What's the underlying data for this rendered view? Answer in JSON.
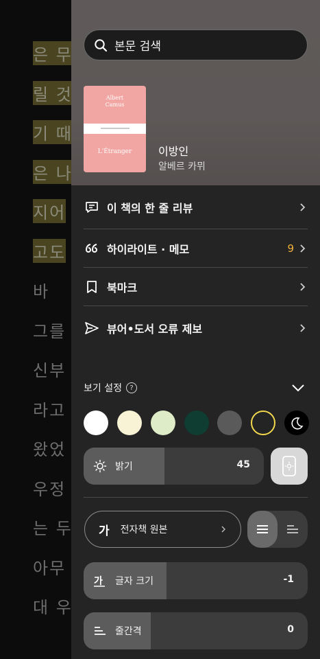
{
  "reader": {
    "lines": [
      {
        "text": "은 무",
        "highlight": true
      },
      {
        "text": "릴 것",
        "highlight": true
      },
      {
        "text": "기 때",
        "highlight": true
      },
      {
        "text": "은 나",
        "highlight": true
      },
      {
        "text": "지어",
        "highlight": true
      },
      {
        "text": "고도",
        "highlight": true
      },
      {
        "text": "   바",
        "highlight": false
      },
      {
        "text": "그를",
        "highlight": false
      },
      {
        "text": "신부",
        "highlight": false
      },
      {
        "text": "라고",
        "highlight": false
      },
      {
        "text": "왔었",
        "highlight": false
      },
      {
        "text": "우정",
        "highlight": false
      },
      {
        "text": "는 두",
        "highlight": false
      },
      {
        "text": "아무",
        "highlight": false
      },
      {
        "text": "대 우",
        "highlight": false
      }
    ]
  },
  "search": {
    "placeholder": "본문 검색",
    "icon": "search-icon"
  },
  "book": {
    "cover_author": "Albert\nCamus",
    "cover_title": "L'Étranger",
    "title": "이방인",
    "author": "알베르 카뮈",
    "cover_color": "#f2a6a3"
  },
  "menu": {
    "items": [
      {
        "label": "이 책의 한 줄 리뷰",
        "icon": "comment-icon"
      },
      {
        "label": "하이라이트 · 메모",
        "icon": "quote-icon",
        "count": "9"
      },
      {
        "label": "북마크",
        "icon": "bookmark-icon"
      },
      {
        "label": "뷰어•도서 오류 제보",
        "icon": "send-icon"
      }
    ]
  },
  "view_settings": {
    "title": "보기 설정",
    "help": "?",
    "themes": [
      {
        "name": "white",
        "color": "#ffffff"
      },
      {
        "name": "cream",
        "color": "#f9f3d6"
      },
      {
        "name": "light-green",
        "color": "#dfecc8"
      },
      {
        "name": "dark-green",
        "color": "#0f3d31"
      },
      {
        "name": "gray",
        "color": "#5a5a5a"
      },
      {
        "name": "black",
        "color": "#242424",
        "selected": true
      },
      {
        "name": "dark-mode",
        "color": "#000000"
      }
    ],
    "brightness": {
      "label": "밝기",
      "value": "45",
      "level": 0.45
    },
    "font": {
      "icon_text": "가",
      "label": "전자책 원본"
    },
    "font_size": {
      "label": "글자 크기",
      "value": "-1",
      "level": 0.37
    },
    "line_spacing": {
      "label": "줄간격",
      "value": "0",
      "level": 0.3
    }
  },
  "colors": {
    "accent": "#f2b33d",
    "panel": "#242424",
    "selected_ring": "#f1d84c"
  }
}
